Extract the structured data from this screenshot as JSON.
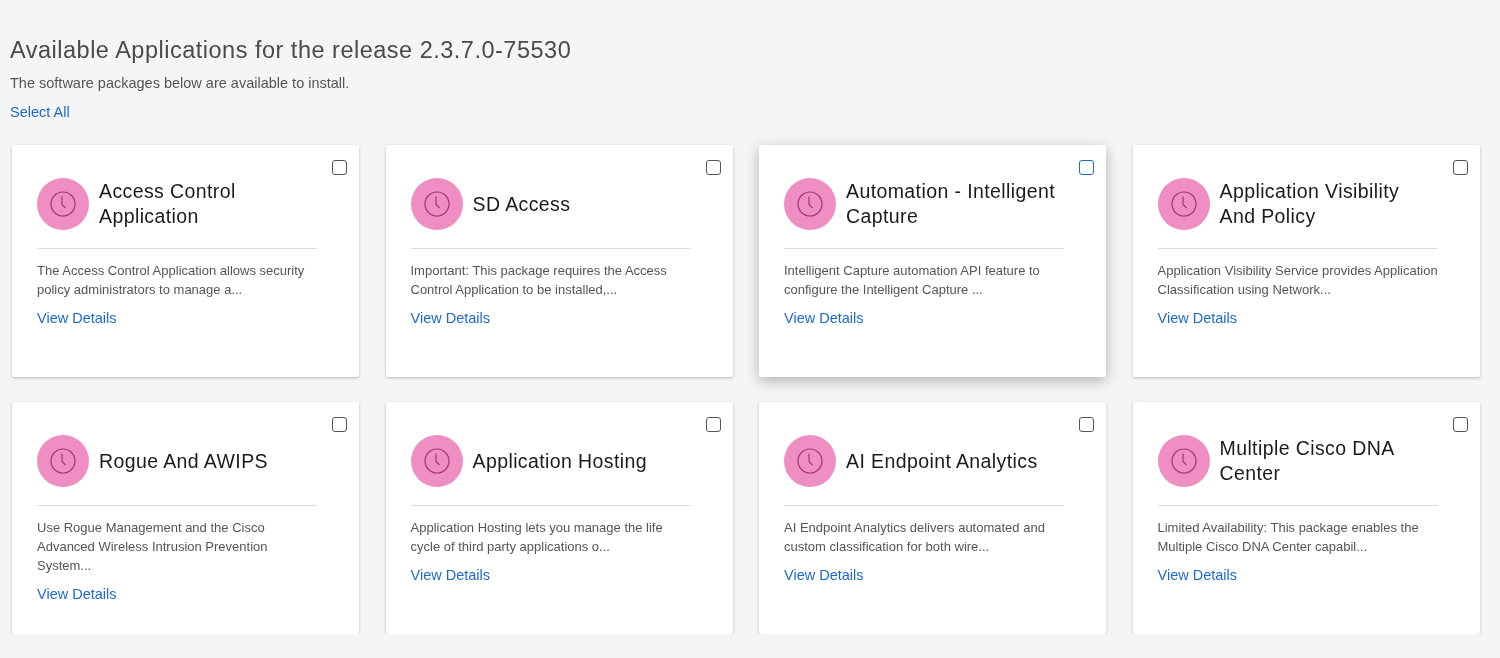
{
  "page": {
    "title": "Available Applications for the release 2.3.7.0-75530",
    "subtitle": "The software packages below are available to install.",
    "select_all": "Select All"
  },
  "applications": [
    {
      "name": "Access Control Application",
      "description": "The Access Control Application allows security policy administrators to manage a...",
      "link": "View Details",
      "checked": false,
      "hovered": false
    },
    {
      "name": "SD Access",
      "description": "Important: This package requires the Access Control Application to be installed,...",
      "link": "View Details",
      "checked": false,
      "hovered": false
    },
    {
      "name": "Automation - Intelligent Capture",
      "description": "Intelligent Capture automation API feature to configure the Intelligent Capture ...",
      "link": "View Details",
      "checked": false,
      "hovered": true
    },
    {
      "name": "Application Visibility And Policy",
      "description": "Application Visibility Service provides Application Classification using Network...",
      "link": "View Details",
      "checked": false,
      "hovered": false
    },
    {
      "name": "Rogue And AWIPS",
      "description": "Use Rogue Management and the Cisco Advanced Wireless Intrusion Prevention System...",
      "link": "View Details",
      "checked": false,
      "hovered": false
    },
    {
      "name": "Application Hosting",
      "description": "Application Hosting lets you manage the life cycle of third party applications o...",
      "link": "View Details",
      "checked": false,
      "hovered": false
    },
    {
      "name": "AI Endpoint Analytics",
      "description": "AI Endpoint Analytics delivers automated and custom classification for both wire...",
      "link": "View Details",
      "checked": false,
      "hovered": false
    },
    {
      "name": "Multiple Cisco DNA Center",
      "description": "Limited Availability: This package enables the Multiple Cisco DNA Center capabil...",
      "link": "View Details",
      "checked": false,
      "hovered": false
    }
  ]
}
